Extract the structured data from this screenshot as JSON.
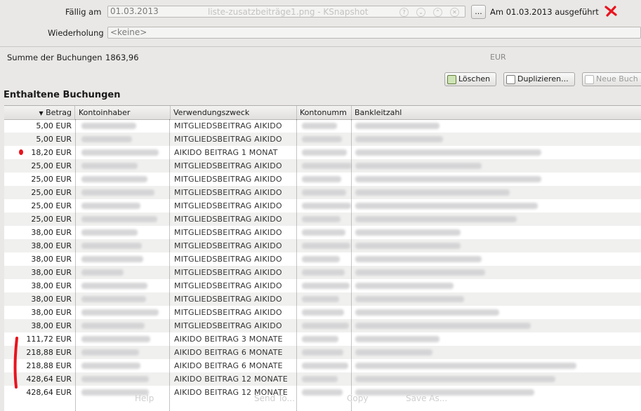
{
  "window": {
    "overlay_title": "liste-zusatzbeiträge1.png - KSnapshot",
    "window_buttons": [
      "?",
      "⌄",
      "⌃",
      "✕"
    ]
  },
  "form": {
    "faellig_label": "Fällig am",
    "faellig_value": "01.03.2013",
    "picker_label": "...",
    "executed_text": "Am 01.03.2013 ausgeführt",
    "wiederholung_label": "Wiederholung",
    "wiederholung_value": "<keine>",
    "summe_label": "Summe der Buchungen",
    "summe_value": "1863,96",
    "currency": "EUR"
  },
  "toolbar": {
    "delete_label": "Löschen",
    "duplicate_label": "Duplizieren...",
    "new_label": "Neue Buch"
  },
  "section_title": "Enthaltene Buchungen",
  "table": {
    "columns": [
      "Betrag",
      "Kontoinhaber",
      "Verwendungszweck",
      "Kontonumm",
      "Bankleitzahl"
    ],
    "rows": [
      {
        "betrag": "5,00 EUR",
        "zweck": "MITGLIEDSBEITRAG AIKIDO"
      },
      {
        "betrag": "5,00 EUR",
        "zweck": "MITGLIEDSBEITRAG AIKIDO"
      },
      {
        "betrag": "18,20 EUR",
        "zweck": "AIKIDO BEITRAG 1 MONAT"
      },
      {
        "betrag": "25,00 EUR",
        "zweck": "MITGLIEDSBEITRAG AIKIDO"
      },
      {
        "betrag": "25,00 EUR",
        "zweck": "MITGLIEDSBEITRAG AIKIDO"
      },
      {
        "betrag": "25,00 EUR",
        "zweck": "MITGLIEDSBEITRAG AIKIDO"
      },
      {
        "betrag": "25,00 EUR",
        "zweck": "MITGLIEDSBEITRAG AIKIDO"
      },
      {
        "betrag": "25,00 EUR",
        "zweck": "MITGLIEDSBEITRAG AIKIDO"
      },
      {
        "betrag": "38,00 EUR",
        "zweck": "MITGLIEDSBEITRAG AIKIDO"
      },
      {
        "betrag": "38,00 EUR",
        "zweck": "MITGLIEDSBEITRAG AIKIDO"
      },
      {
        "betrag": "38,00 EUR",
        "zweck": "MITGLIEDSBEITRAG AIKIDO"
      },
      {
        "betrag": "38,00 EUR",
        "zweck": "MITGLIEDSBEITRAG AIKIDO"
      },
      {
        "betrag": "38,00 EUR",
        "zweck": "MITGLIEDSBEITRAG AIKIDO"
      },
      {
        "betrag": "38,00 EUR",
        "zweck": "MITGLIEDSBEITRAG AIKIDO"
      },
      {
        "betrag": "38,00 EUR",
        "zweck": "MITGLIEDSBEITRAG AIKIDO"
      },
      {
        "betrag": "38,00 EUR",
        "zweck": "MITGLIEDSBEITRAG AIKIDO"
      },
      {
        "betrag": "111,72 EUR",
        "zweck": "AIKIDO BEITRAG 3 MONATE"
      },
      {
        "betrag": "218,88 EUR",
        "zweck": "AIKIDO BEITRAG 6 MONATE"
      },
      {
        "betrag": "218,88 EUR",
        "zweck": "AIKIDO BEITRAG 6 MONATE"
      },
      {
        "betrag": "428,64 EUR",
        "zweck": "AIKIDO BEITRAG 12 MONATE"
      },
      {
        "betrag": "428,64 EUR",
        "zweck": "AIKIDO BEITRAG 12 MONATE"
      }
    ]
  },
  "ghost_overlay": {
    "help": "Help",
    "send_to": "Send To...",
    "copy": "Copy",
    "save_as": "Save As..."
  },
  "colors": {
    "annotation_red": "#e8141e",
    "header_bg": "#e6e5e3"
  }
}
